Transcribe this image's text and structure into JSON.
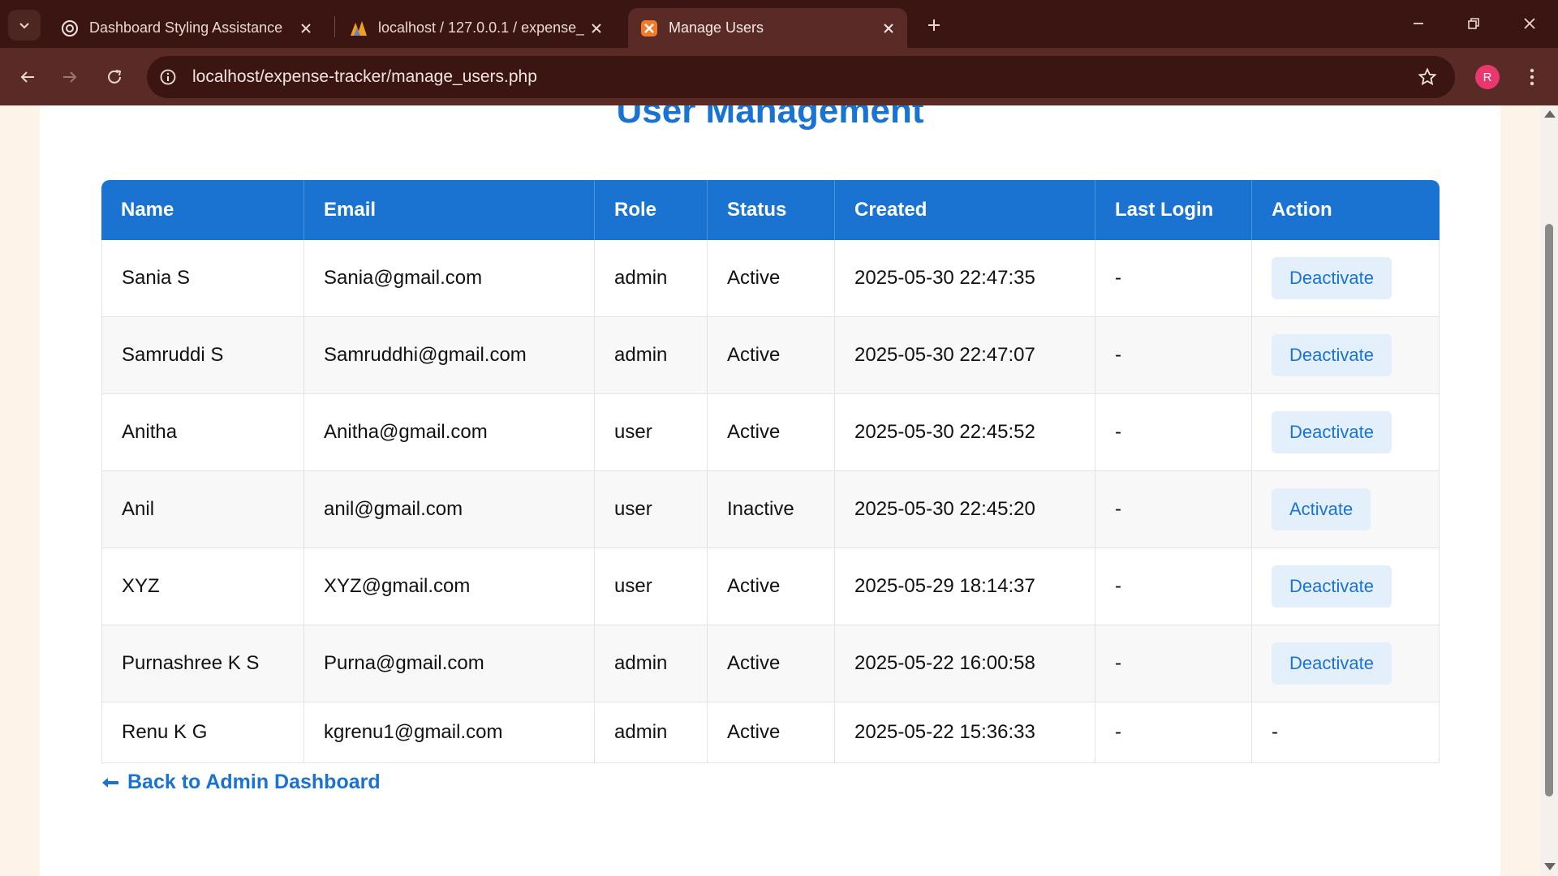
{
  "browser": {
    "tabs": [
      {
        "title": "Dashboard Styling Assistance",
        "icon": "openai-icon"
      },
      {
        "title": "localhost / 127.0.0.1 / expense_",
        "icon": "phpmyadmin-icon"
      },
      {
        "title": "Manage Users",
        "icon": "xampp-icon",
        "active": true
      }
    ],
    "url": "localhost/expense-tracker/manage_users.php",
    "profile_initial": "R"
  },
  "page": {
    "title": "User Management",
    "table": {
      "headers": [
        "Name",
        "Email",
        "Role",
        "Status",
        "Created",
        "Last Login",
        "Action"
      ],
      "rows": [
        {
          "name": "Sania S",
          "email": "Sania@gmail.com",
          "role": "admin",
          "status": "Active",
          "created": "2025-05-30 22:47:35",
          "last_login": "-",
          "action": "Deactivate"
        },
        {
          "name": "Samruddi S",
          "email": "Samruddhi@gmail.com",
          "role": "admin",
          "status": "Active",
          "created": "2025-05-30 22:47:07",
          "last_login": "-",
          "action": "Deactivate"
        },
        {
          "name": "Anitha",
          "email": "Anitha@gmail.com",
          "role": "user",
          "status": "Active",
          "created": "2025-05-30 22:45:52",
          "last_login": "-",
          "action": "Deactivate"
        },
        {
          "name": "Anil",
          "email": "anil@gmail.com",
          "role": "user",
          "status": "Inactive",
          "created": "2025-05-30 22:45:20",
          "last_login": "-",
          "action": "Activate"
        },
        {
          "name": "XYZ",
          "email": "XYZ@gmail.com",
          "role": "user",
          "status": "Active",
          "created": "2025-05-29 18:14:37",
          "last_login": "-",
          "action": "Deactivate"
        },
        {
          "name": "Purnashree K S",
          "email": "Purna@gmail.com",
          "role": "admin",
          "status": "Active",
          "created": "2025-05-22 16:00:58",
          "last_login": "-",
          "action": "Deactivate"
        },
        {
          "name": "Renu K G",
          "email": "kgrenu1@gmail.com",
          "role": "admin",
          "status": "Active",
          "created": "2025-05-22 15:36:33",
          "last_login": "-",
          "action": "-"
        }
      ]
    },
    "back_link": "Back to Admin Dashboard"
  },
  "colors": {
    "accent": "#1a73d1",
    "tabstrip_bg": "#3a1512",
    "toolbar_bg": "#5a2b26",
    "page_bg": "#fdf3e8"
  }
}
